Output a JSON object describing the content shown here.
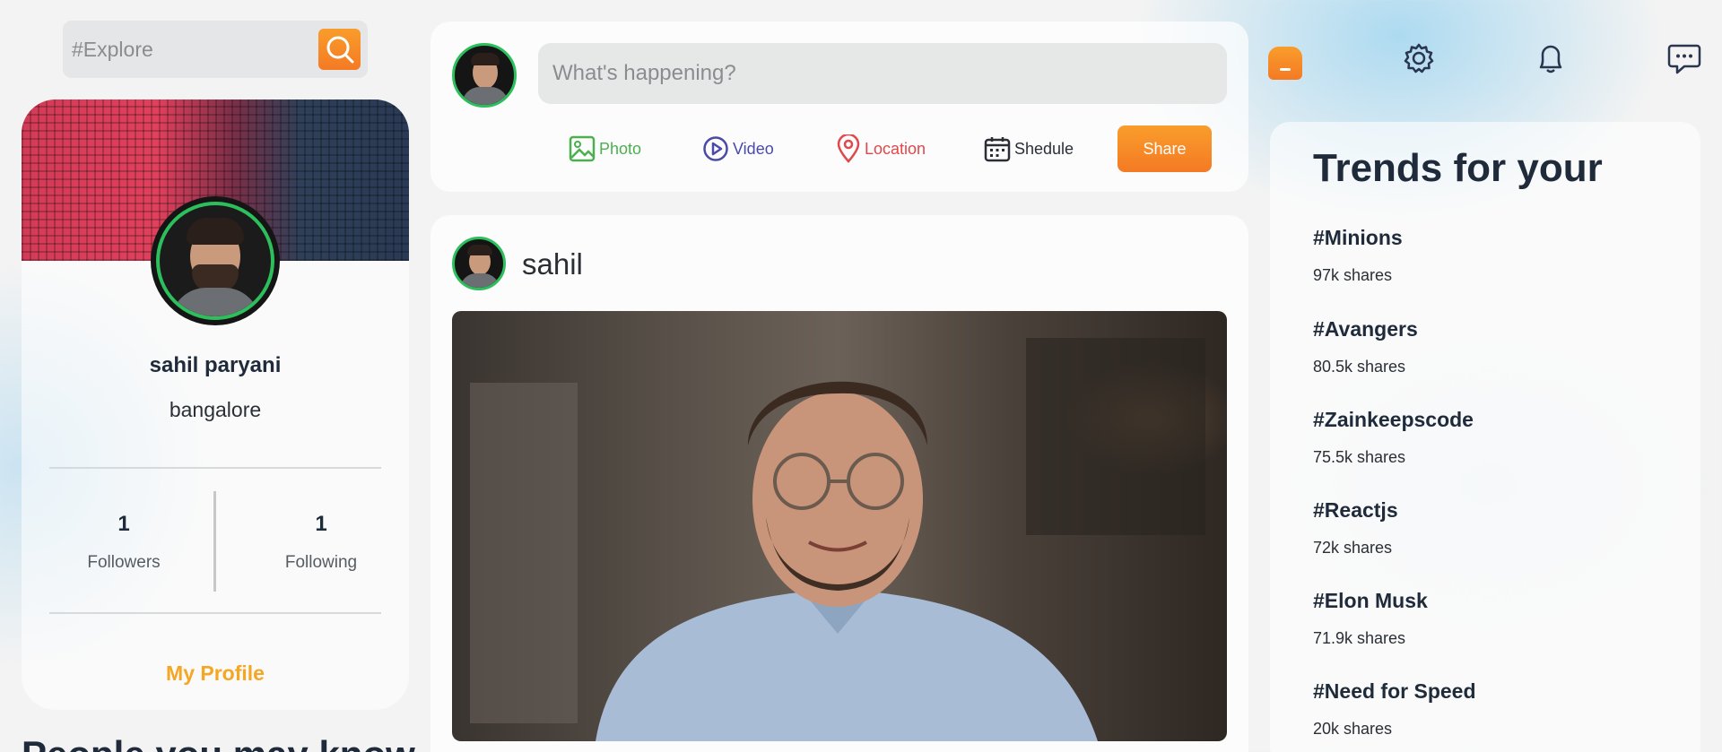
{
  "search": {
    "placeholder": "#Explore"
  },
  "profile": {
    "name": "sahil paryani",
    "location": "bangalore",
    "followers_count": "1",
    "followers_label": "Followers",
    "following_count": "1",
    "following_label": "Following",
    "my_profile_label": "My Profile"
  },
  "people_heading": "People you may know",
  "composer": {
    "placeholder": "What's happening?",
    "actions": [
      {
        "label": "Photo",
        "color": "#4caf50",
        "icon": "image-icon"
      },
      {
        "label": "Video",
        "color": "#4a4aa8",
        "icon": "play-circle-icon"
      },
      {
        "label": "Location",
        "color": "#e0484c",
        "icon": "map-pin-icon"
      },
      {
        "label": "Shedule",
        "color": "#2a2f36",
        "icon": "calendar-icon"
      }
    ],
    "share_label": "Share"
  },
  "post": {
    "author": "sahil"
  },
  "nav_icons": [
    "home-icon",
    "gear-icon",
    "bell-icon",
    "chat-icon"
  ],
  "trends": {
    "title": "Trends for your",
    "items": [
      {
        "tag": "#Minions",
        "shares": "97k shares"
      },
      {
        "tag": "#Avangers",
        "shares": "80.5k shares"
      },
      {
        "tag": "#Zainkeepscode",
        "shares": "75.5k shares"
      },
      {
        "tag": "#Reactjs",
        "shares": "72k shares"
      },
      {
        "tag": "#Elon Musk",
        "shares": "71.9k shares"
      },
      {
        "tag": "#Need for Speed",
        "shares": "20k shares"
      }
    ]
  },
  "colors": {
    "accent": "#f5a623",
    "accent_gradient_top": "#f99d2b",
    "accent_gradient_bottom": "#f47a24",
    "avatar_ring": "#2dbf5c"
  }
}
